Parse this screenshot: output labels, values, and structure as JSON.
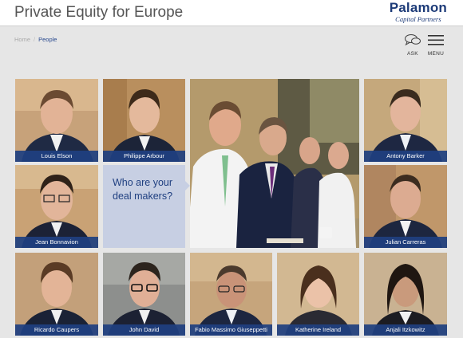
{
  "header": {
    "title": "Private Equity for Europe",
    "logo_main": "Palamon",
    "logo_sub": "Capital Partners"
  },
  "breadcrumb": {
    "home": "Home",
    "separator": "/",
    "current": "People"
  },
  "utilities": {
    "ask_label": "ASK",
    "menu_label": "MENU"
  },
  "cta": {
    "line1": "Who are your",
    "line2": "deal makers?"
  },
  "people": [
    {
      "name": "Louis Elson"
    },
    {
      "name": "Philippe Arbour"
    },
    {
      "name": "Antony Barker"
    },
    {
      "name": "Jean Bonnavion"
    },
    {
      "name": "Julian Carreras"
    },
    {
      "name": "Ricardo Caupers"
    },
    {
      "name": "John David"
    },
    {
      "name": "Fabio Massimo Giuseppetti"
    },
    {
      "name": "Katherine Ireland"
    },
    {
      "name": "Anjali Itzkowitz"
    }
  ],
  "colors": {
    "accent": "#1f3f80",
    "cta_background": "#c7cfe3",
    "page_background": "#e6e6e6"
  },
  "icons": [
    "chat-bubbles-icon",
    "hamburger-menu-icon"
  ]
}
